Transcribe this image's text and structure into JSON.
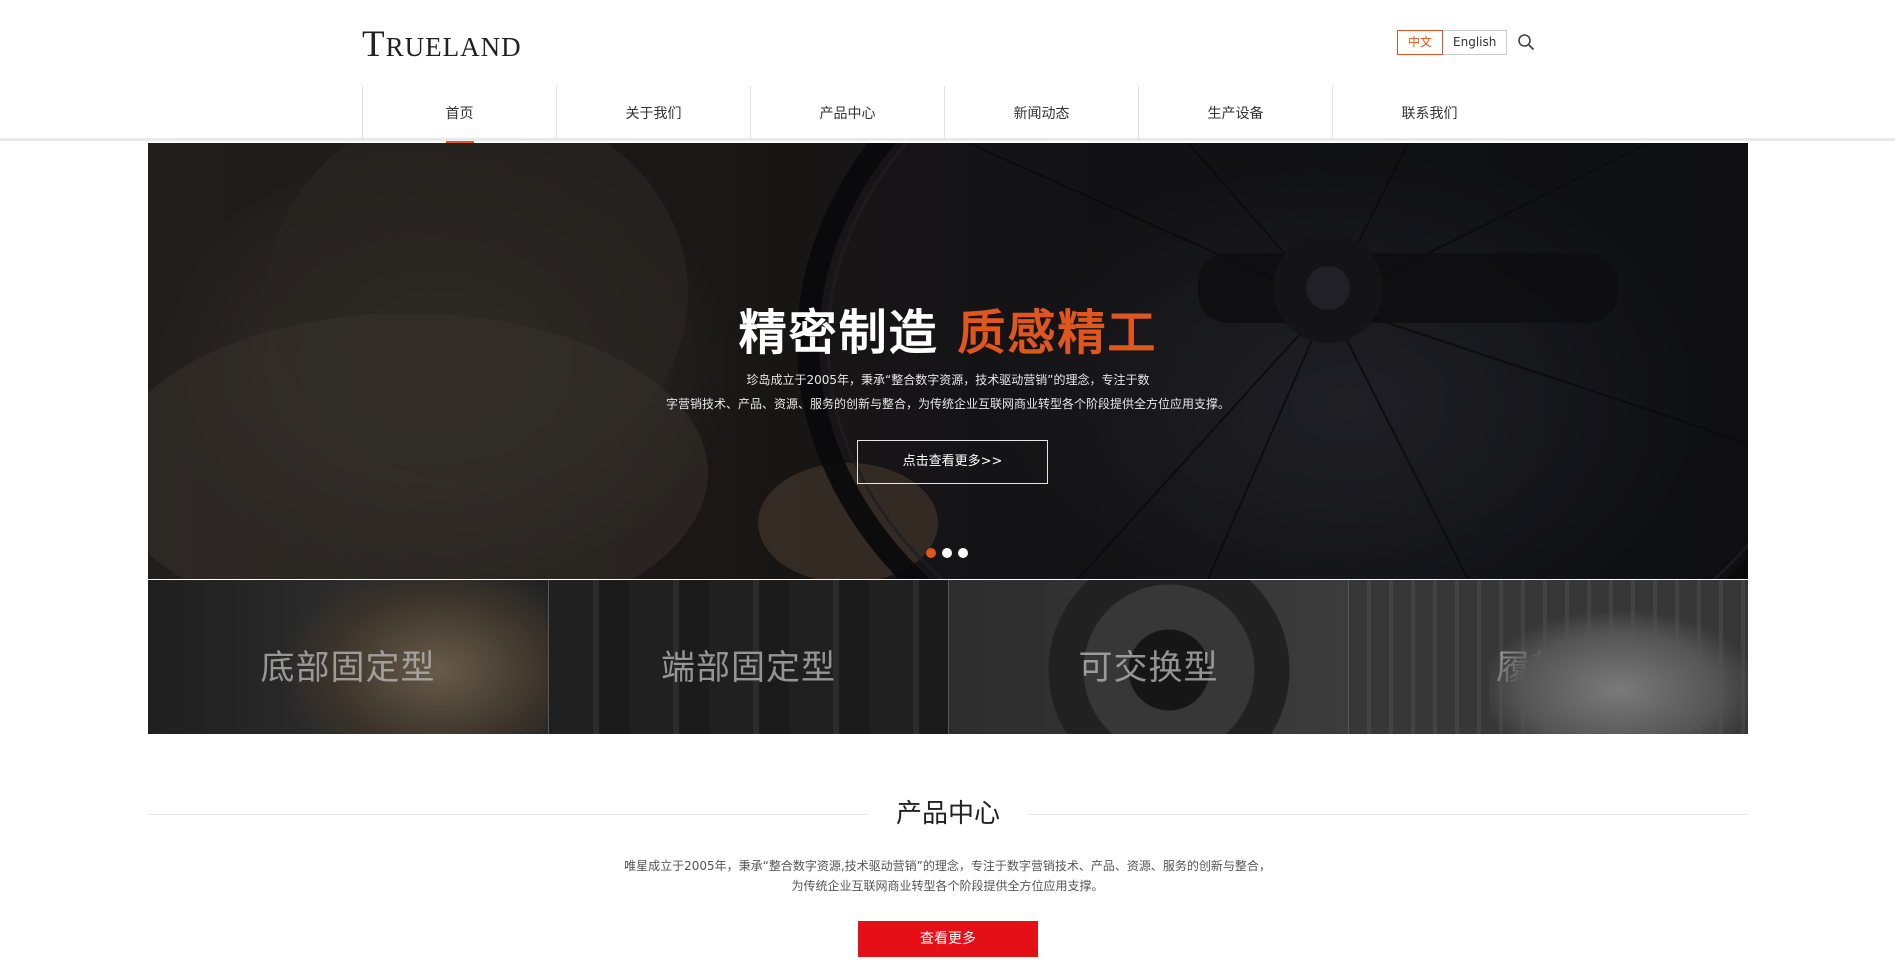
{
  "header": {
    "logo": {
      "initial": "T",
      "rest": "RUELAND"
    },
    "languages": [
      {
        "label": "中文",
        "active": true
      },
      {
        "label": "English",
        "active": false
      }
    ],
    "search_icon": "search-icon"
  },
  "nav": {
    "items": [
      {
        "label": "首页",
        "active": true
      },
      {
        "label": "关于我们",
        "active": false
      },
      {
        "label": "产品中心",
        "active": false
      },
      {
        "label": "新闻动态",
        "active": false
      },
      {
        "label": "生产设备",
        "active": false
      },
      {
        "label": "联系我们",
        "active": false
      }
    ]
  },
  "banner": {
    "title_main": "精密制造",
    "title_accent": "质感精工",
    "desc_line1": "珍岛成立于2005年，秉承“整合数字资源，技术驱动营销”的理念，专注于数",
    "desc_line2": "字营销技术、产品、资源、服务的创新与整合，为传统企业互联网商业转型各个阶段提供全方位应用支撑。",
    "button_label": "点击查看更多>>",
    "slides_total": 3,
    "active_slide": 1
  },
  "categories": [
    {
      "label": "底部固定型"
    },
    {
      "label": "端部固定型"
    },
    {
      "label": "可交换型"
    },
    {
      "label": "履带型"
    }
  ],
  "products_section": {
    "title": "产品中心",
    "desc": "唯星成立于2005年，秉承“整合数字资源,技术驱动营销”的理念，专注于数字营销技术、产品、资源、服务的创新与整合，为传统企业互联网商业转型各个阶段提供全方位应用支撑。",
    "button_label": "查看更多"
  },
  "colors": {
    "accent_orange": "#e0561f",
    "button_red": "#e50f17"
  }
}
